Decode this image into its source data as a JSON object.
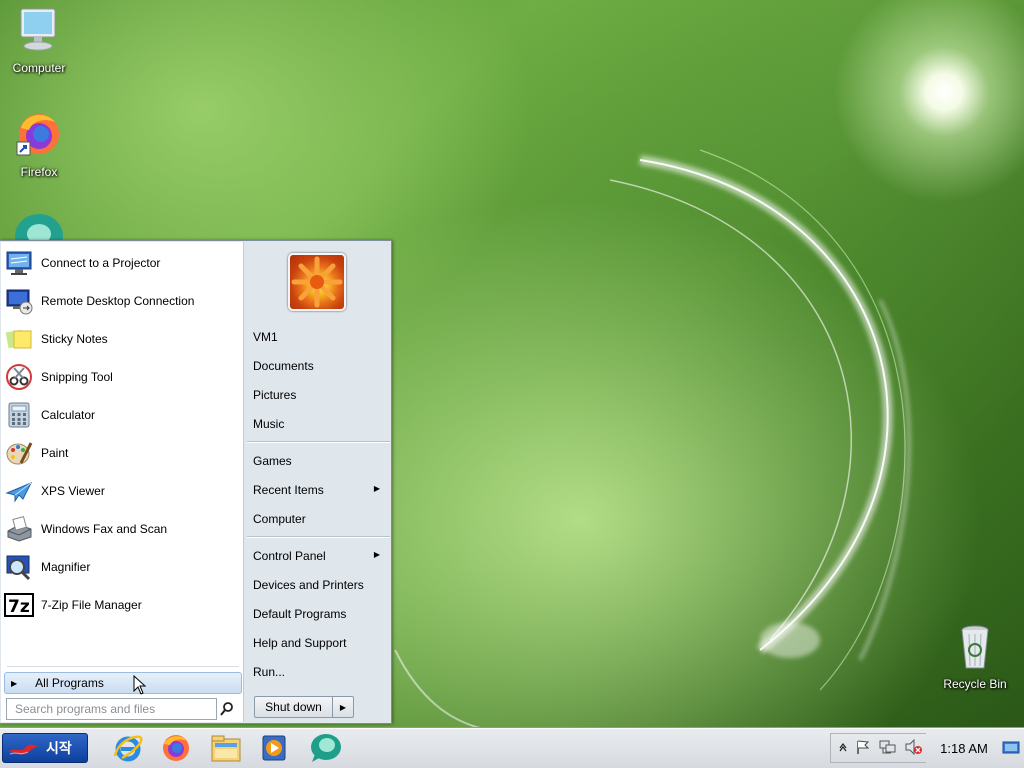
{
  "desktop": {
    "icons": [
      {
        "name": "computer",
        "label": "Computer"
      },
      {
        "name": "firefox",
        "label": "Firefox"
      },
      {
        "name": "recycle-bin",
        "label": "Recycle Bin"
      }
    ]
  },
  "start_menu": {
    "programs": [
      {
        "label": "Connect to a Projector",
        "icon": "projector-icon"
      },
      {
        "label": "Remote Desktop Connection",
        "icon": "remote-desktop-icon"
      },
      {
        "label": "Sticky Notes",
        "icon": "sticky-notes-icon"
      },
      {
        "label": "Snipping Tool",
        "icon": "scissors-icon"
      },
      {
        "label": "Calculator",
        "icon": "calculator-icon"
      },
      {
        "label": "Paint",
        "icon": "paint-palette-icon"
      },
      {
        "label": "XPS Viewer",
        "icon": "xps-viewer-icon"
      },
      {
        "label": "Windows Fax and Scan",
        "icon": "fax-scanner-icon"
      },
      {
        "label": "Magnifier",
        "icon": "magnifier-icon"
      },
      {
        "label": "7-Zip File Manager",
        "icon": "7zip-icon"
      }
    ],
    "all_programs": "All Programs",
    "search_placeholder": "Search programs and files",
    "right_items": {
      "user": "VM1",
      "documents": "Documents",
      "pictures": "Pictures",
      "music": "Music",
      "games": "Games",
      "recent_items": "Recent Items",
      "computer": "Computer",
      "control_panel": "Control Panel",
      "devices_printers": "Devices and Printers",
      "default_programs": "Default Programs",
      "help_support": "Help and Support",
      "run": "Run..."
    },
    "shutdown_label": "Shut down"
  },
  "taskbar": {
    "start_label": "시작",
    "pinned": [
      "internet-explorer-icon",
      "firefox-icon",
      "file-explorer-icon",
      "media-player-icon",
      "app-bubble-icon"
    ],
    "clock": "1:18 AM"
  }
}
